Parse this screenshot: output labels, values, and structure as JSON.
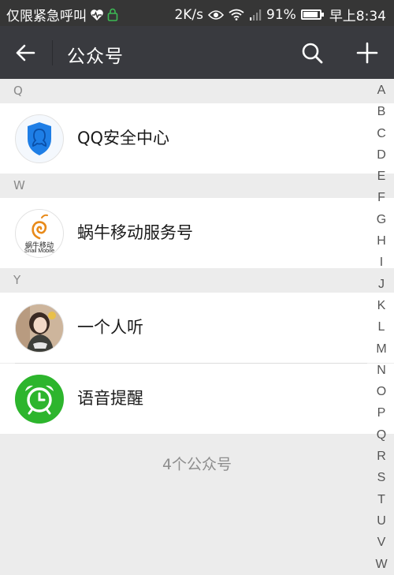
{
  "status_bar": {
    "left_text": "仅限紧急呼叫",
    "speed": "2K/s",
    "battery_percent": "91%",
    "battery_level": 0.91,
    "time": "早上8:34",
    "icons": [
      "heart-icon",
      "lock-icon",
      "eye-icon",
      "wifi-icon",
      "signal-icon",
      "battery-icon"
    ]
  },
  "header": {
    "title": "公众号",
    "back_icon": "arrow-left-icon",
    "search_icon": "search-icon",
    "add_icon": "plus-icon"
  },
  "sections": [
    {
      "letter": "Q",
      "items": [
        {
          "name": "QQ安全中心",
          "avatar": "qq-security-shield-avatar"
        }
      ]
    },
    {
      "letter": "W",
      "items": [
        {
          "name": "蜗牛移动服务号",
          "avatar": "snail-mobile-logo-avatar",
          "logo_text": "蜗牛移动",
          "logo_subtext": "Snail Mobile"
        }
      ]
    },
    {
      "letter": "Y",
      "items": [
        {
          "name": "一个人听",
          "avatar": "photo-avatar"
        },
        {
          "name": "语音提醒",
          "avatar": "alarm-clock-avatar"
        }
      ]
    }
  ],
  "footer": {
    "count_text": "4个公众号"
  },
  "alphabet_index": [
    "A",
    "B",
    "C",
    "D",
    "E",
    "F",
    "G",
    "H",
    "I",
    "J",
    "K",
    "L",
    "M",
    "N",
    "O",
    "P",
    "Q",
    "R",
    "S",
    "T",
    "U",
    "V",
    "W"
  ],
  "colors": {
    "header_bg": "#393a3f",
    "status_bg": "#363636",
    "page_bg": "#ececec",
    "qq_blue": "#1e7ee6",
    "alarm_green": "#2db52d",
    "snail_orange": "#e88a1a"
  }
}
